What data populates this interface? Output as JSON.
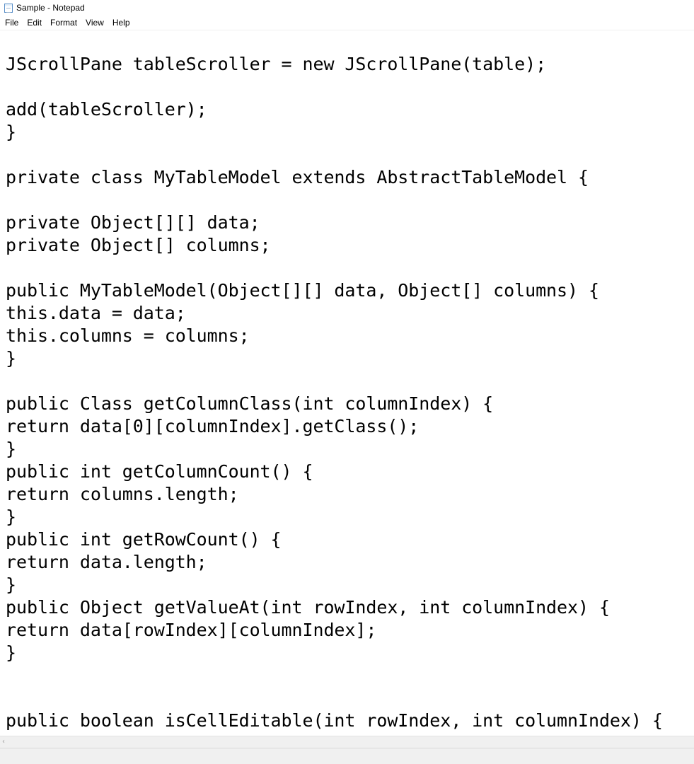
{
  "window": {
    "title": "Sample - Notepad",
    "icon": "notepad-icon"
  },
  "menu": {
    "items": [
      "File",
      "Edit",
      "Format",
      "View",
      "Help"
    ]
  },
  "editor": {
    "lines": [
      "JScrollPane tableScroller = new JScrollPane(table);",
      "",
      "add(tableScroller);",
      "}",
      "",
      "private class MyTableModel extends AbstractTableModel {",
      "",
      "private Object[][] data;",
      "private Object[] columns;",
      "",
      "public MyTableModel(Object[][] data, Object[] columns) {",
      "this.data = data;",
      "this.columns = columns;",
      "}",
      "",
      "public Class getColumnClass(int columnIndex) {",
      "return data[0][columnIndex].getClass();",
      "}",
      "public int getColumnCount() {",
      "return columns.length;",
      "}",
      "public int getRowCount() {",
      "return data.length;",
      "}",
      "public Object getValueAt(int rowIndex, int columnIndex) {",
      "return data[rowIndex][columnIndex];",
      "}",
      "",
      "",
      "public boolean isCellEditable(int rowIndex, int columnIndex) {"
    ]
  },
  "scrollbar": {
    "left_arrow_icon": "chevron-left-icon",
    "left_arrow_glyph": "‹"
  }
}
